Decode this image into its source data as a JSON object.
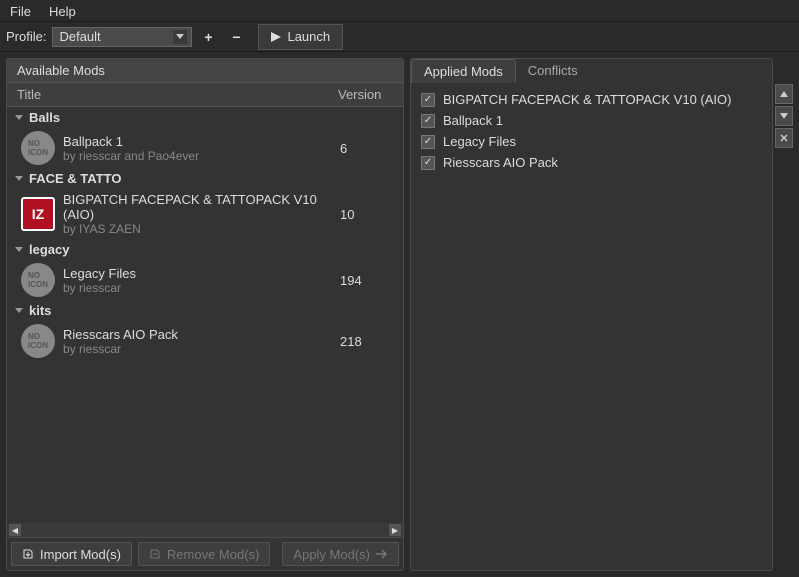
{
  "menu": {
    "file": "File",
    "help": "Help"
  },
  "toolbar": {
    "profile_label": "Profile:",
    "profile_value": "Default",
    "launch_label": "Launch"
  },
  "left": {
    "header": "Available Mods",
    "col_title": "Title",
    "col_version": "Version",
    "groups": [
      {
        "name": "Balls",
        "mods": [
          {
            "title": "Ballpack 1",
            "author": "by riesscar and Pao4ever",
            "version": "6",
            "icon": "none"
          }
        ]
      },
      {
        "name": "FACE & TATTO",
        "mods": [
          {
            "title": "BIGPATCH FACEPACK & TATTOPACK V10 (AIO)",
            "author": "by IYAS ZAEN",
            "version": "10",
            "icon": "iz"
          }
        ]
      },
      {
        "name": "legacy",
        "mods": [
          {
            "title": "Legacy Files",
            "author": "by riesscar",
            "version": "194",
            "icon": "none"
          }
        ]
      },
      {
        "name": "kits",
        "mods": [
          {
            "title": "Riesscars AIO Pack",
            "author": "by riesscar",
            "version": "218",
            "icon": "none"
          }
        ]
      }
    ],
    "buttons": {
      "import": "Import Mod(s)",
      "remove": "Remove Mod(s)",
      "apply": "Apply Mod(s)"
    }
  },
  "right": {
    "tabs": {
      "applied": "Applied Mods",
      "conflicts": "Conflicts"
    },
    "items": [
      "BIGPATCH FACEPACK & TATTOPACK V10 (AIO)",
      "Ballpack 1",
      "Legacy Files",
      "Riesscars AIO Pack"
    ]
  }
}
